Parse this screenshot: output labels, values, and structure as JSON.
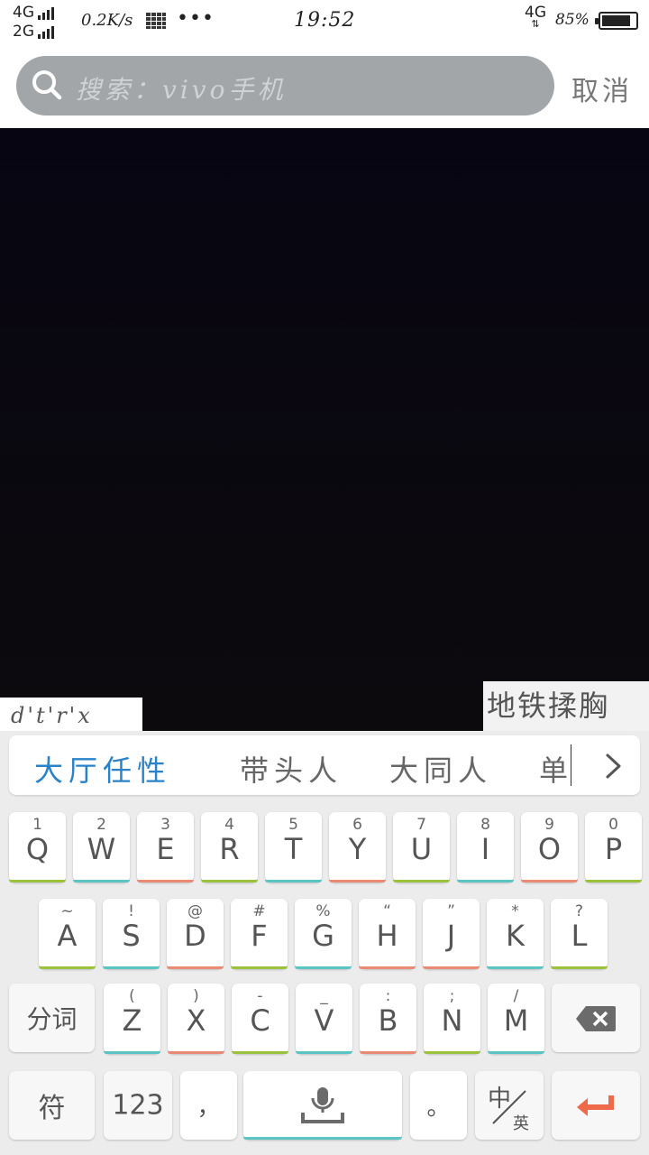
{
  "status_bar": {
    "net1": "4G",
    "net2": "2G",
    "speed": "0.2K/s",
    "more": "•••",
    "time": "19:52",
    "net_right": "4G",
    "battery_pct": "85%",
    "battery_level": 0.85
  },
  "search": {
    "placeholder": "搜索：vivo手机",
    "cancel_label": "取消"
  },
  "compose": {
    "pinyin": "d't'r'x",
    "hint": "地铁揉胸"
  },
  "candidates": [
    "大厅任性",
    "带头人",
    "大同人",
    "单"
  ],
  "keyboard": {
    "row1": [
      {
        "key": "Q",
        "sub": "1",
        "color": "#9ac23c"
      },
      {
        "key": "W",
        "sub": "2",
        "color": "#5bc4c4"
      },
      {
        "key": "E",
        "sub": "3",
        "color": "#e88a74"
      },
      {
        "key": "R",
        "sub": "4",
        "color": "#9ac23c"
      },
      {
        "key": "T",
        "sub": "5",
        "color": "#5bc4c4"
      },
      {
        "key": "Y",
        "sub": "6",
        "color": "#e88a74"
      },
      {
        "key": "U",
        "sub": "7",
        "color": "#9ac23c"
      },
      {
        "key": "I",
        "sub": "8",
        "color": "#5bc4c4"
      },
      {
        "key": "O",
        "sub": "9",
        "color": "#e88a74"
      },
      {
        "key": "P",
        "sub": "0",
        "color": "#9ac23c"
      }
    ],
    "row2": [
      {
        "key": "A",
        "sub": "~",
        "color": "#9ac23c"
      },
      {
        "key": "S",
        "sub": "!",
        "color": "#5bc4c4"
      },
      {
        "key": "D",
        "sub": "@",
        "color": "#e88a74"
      },
      {
        "key": "F",
        "sub": "#",
        "color": "#9ac23c"
      },
      {
        "key": "G",
        "sub": "%",
        "color": "#5bc4c4"
      },
      {
        "key": "H",
        "sub": "“",
        "color": "#e88a74"
      },
      {
        "key": "J",
        "sub": "”",
        "color": "#e88a74"
      },
      {
        "key": "K",
        "sub": "*",
        "color": "#5bc4c4"
      },
      {
        "key": "L",
        "sub": "?",
        "color": "#9ac23c"
      }
    ],
    "row3": [
      {
        "key": "Z",
        "sub": "(",
        "color": "#5bc4c4"
      },
      {
        "key": "X",
        "sub": ")",
        "color": "#e88a74"
      },
      {
        "key": "C",
        "sub": "-",
        "color": "#9ac23c"
      },
      {
        "key": "V",
        "sub": "_",
        "color": "#5bc4c4"
      },
      {
        "key": "B",
        "sub": ":",
        "color": "#e88a74"
      },
      {
        "key": "N",
        "sub": ";",
        "color": "#9ac23c"
      },
      {
        "key": "M",
        "sub": "/",
        "color": "#5bc4c4"
      }
    ],
    "segment_label": "分词",
    "symbol_label": "符",
    "numeric_label": "123",
    "comma_label": "，",
    "period_label": "。",
    "lang_zh": "中",
    "lang_en": "英"
  },
  "colors": {
    "candidate_highlight": "#2a82c8",
    "enter_arrow": "#ee6a4a",
    "search_box": "#a3a6a9"
  }
}
